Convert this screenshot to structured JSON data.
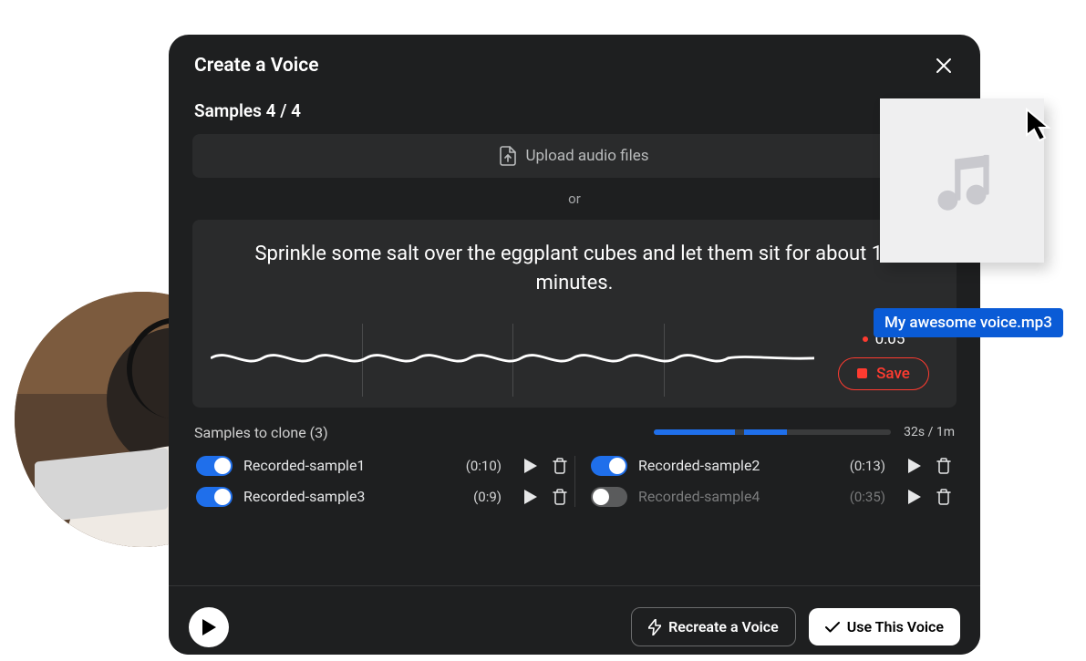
{
  "header": {
    "title": "Create a Voice"
  },
  "samples": {
    "label": "Samples 4 / 4",
    "upload_label": "Upload audio files",
    "or_label": "or"
  },
  "prompt": {
    "text": "Sprinkle some salt over the eggplant cubes and let them sit for about 15 minutes."
  },
  "recording": {
    "time": "0:05",
    "save_label": "Save"
  },
  "clone": {
    "label": "Samples to clone (3)",
    "progress_text": "32s / 1m",
    "items": [
      {
        "name": "Recorded-sample1",
        "duration": "(0:10)",
        "enabled": true
      },
      {
        "name": "Recorded-sample2",
        "duration": "(0:13)",
        "enabled": true
      },
      {
        "name": "Recorded-sample3",
        "duration": "(0:9)",
        "enabled": true
      },
      {
        "name": "Recorded-sample4",
        "duration": "(0:35)",
        "enabled": false
      }
    ]
  },
  "footer": {
    "recreate_label": "Recreate a Voice",
    "use_label": "Use This Voice"
  },
  "drag": {
    "filename": "My awesome voice.mp3"
  },
  "colors": {
    "accent_blue": "#1f6feb",
    "danger_red": "#ff3b30"
  }
}
